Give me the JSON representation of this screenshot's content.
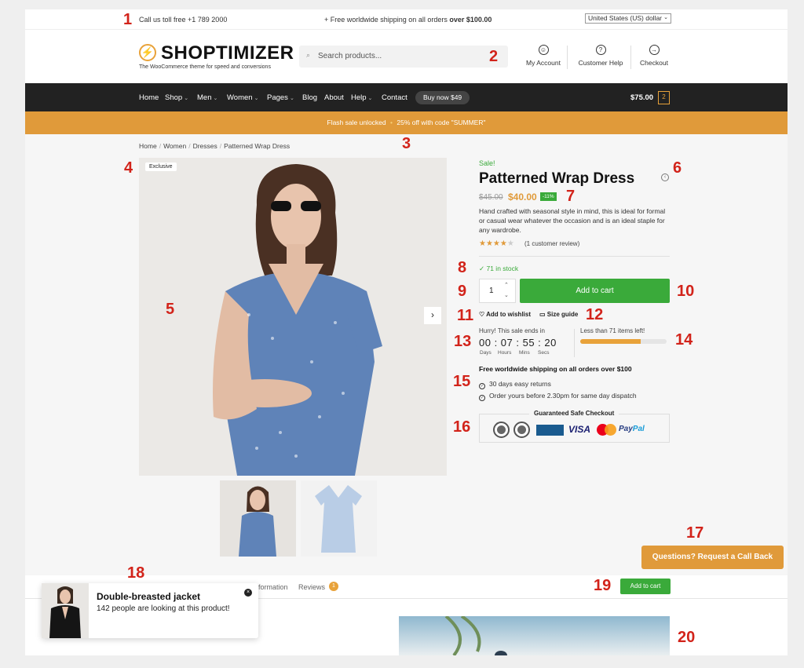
{
  "topbar": {
    "phone": "Call us toll free +1 789 2000",
    "shipping_prefix": "+ Free worldwide shipping on all orders ",
    "shipping_bold": "over $100.00",
    "currency": "United States (US) dollar"
  },
  "header": {
    "logo_symbol": "⚡",
    "logo": "SHOPTIMIZER",
    "tagline": "The WooCommerce theme for speed and conversions",
    "search_placeholder": "Search products...",
    "account": "My Account",
    "help": "Customer Help",
    "checkout": "Checkout"
  },
  "nav": {
    "items": [
      "Home",
      "Shop",
      "Men",
      "Women",
      "Pages",
      "Blog",
      "About",
      "Help",
      "Contact"
    ],
    "caret": "⌄",
    "buy_now": "Buy now $49",
    "cart_total": "$75.00",
    "cart_count": "2"
  },
  "flash": {
    "text": "Flash sale unlocked",
    "dot": "•",
    "code_text": "25% off with code \"SUMMER\""
  },
  "breadcrumb": {
    "items": [
      "Home",
      "Women",
      "Dresses",
      "Patterned Wrap Dress"
    ],
    "separator": "/"
  },
  "gallery": {
    "badge": "Exclusive",
    "next_arrow": "›"
  },
  "product": {
    "sale_label": "Sale!",
    "title": "Patterned Wrap Dress",
    "old_price": "$45.00",
    "new_price": "$40.00",
    "discount": "-11%",
    "description": "Hand crafted with seasonal style in mind, this is ideal for formal or casual wear whatever the occasion and is an ideal staple for any wardrobe.",
    "rating": 4,
    "rating_max": 5,
    "stars_filled": "★★★★",
    "stars_empty": "★",
    "reviews_text": "(1 customer review)",
    "stock": "✓ 71 in stock",
    "quantity": "1",
    "add_to_cart": "Add to cart",
    "wishlist": "Add to wishlist",
    "size_guide": "Size guide"
  },
  "countdown": {
    "heading": "Hurry! This sale ends in",
    "time": "00 : 07 : 55 : 20",
    "labels": [
      "Days",
      "Hours",
      "Mins",
      "Secs"
    ],
    "stock_text": "Less than 71 items left!",
    "stock_fraction": 0.7
  },
  "perks": {
    "heading": "Free worldwide shipping on all orders over $100",
    "items": [
      "30 days easy returns",
      "Order yours before 2.30pm for same day dispatch"
    ],
    "check": "✓"
  },
  "checkout_badges": {
    "title": "Guaranteed Safe Checkout",
    "visa": "VISA",
    "paypal_a": "Pay",
    "paypal_b": "Pal"
  },
  "callback": "Questions? Request a Call Back",
  "tabs": {
    "info": "formation",
    "reviews": "Reviews",
    "reviews_count": "1"
  },
  "sticky_cart": "Add to cart",
  "popup": {
    "title": "Double-breasted jacket",
    "subtitle": "142 people are looking at this product!",
    "close": "×"
  },
  "annotations": [
    "1",
    "2",
    "3",
    "4",
    "5",
    "6",
    "7",
    "8",
    "9",
    "10",
    "11",
    "12",
    "13",
    "14",
    "15",
    "16",
    "17",
    "18",
    "19",
    "20"
  ],
  "colors": {
    "accent": "#e09a3a",
    "green": "#3aaa3a",
    "annotation": "#d2231a",
    "nav": "#222222"
  }
}
